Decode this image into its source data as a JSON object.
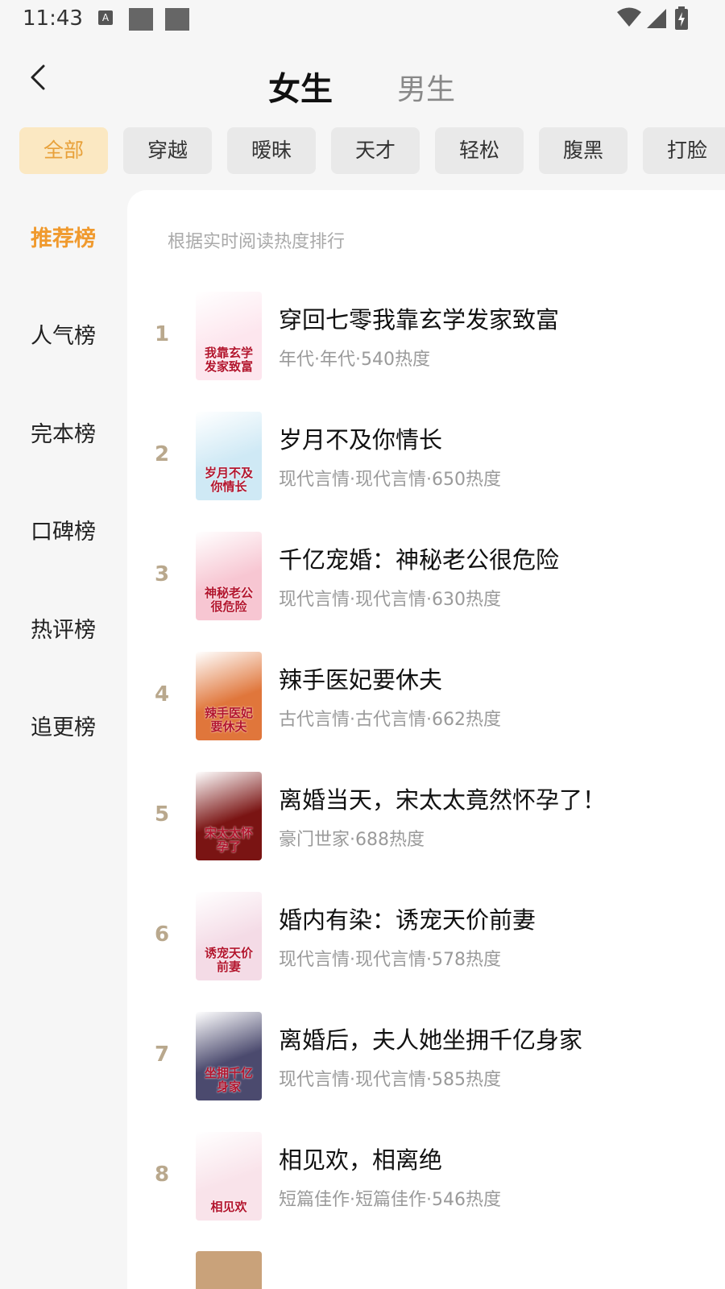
{
  "status_bar": {
    "time": "11:43",
    "icons": [
      "a-icon",
      "notification-square-icon",
      "notification-square-icon",
      "wifi-icon",
      "signal-icon",
      "battery-charging-icon"
    ]
  },
  "header": {
    "back_icon": "back-chevron-icon",
    "tabs": [
      {
        "label": "女生",
        "active": true
      },
      {
        "label": "男生",
        "active": false
      }
    ]
  },
  "filters": [
    {
      "label": "全部",
      "active": true
    },
    {
      "label": "穿越"
    },
    {
      "label": "暧昧"
    },
    {
      "label": "天才"
    },
    {
      "label": "轻松"
    },
    {
      "label": "腹黑"
    },
    {
      "label": "打脸"
    }
  ],
  "side_nav": [
    {
      "label": "推荐榜",
      "active": true
    },
    {
      "label": "人气榜"
    },
    {
      "label": "完本榜"
    },
    {
      "label": "口碑榜"
    },
    {
      "label": "热评榜"
    },
    {
      "label": "追更榜"
    }
  ],
  "list": {
    "subtitle": "根据实时阅读热度排行",
    "books": [
      {
        "rank": "1",
        "title": "穿回七零我靠玄学发家致富",
        "meta": "年代·年代·540热度",
        "cover_text": "我靠玄学发家致富",
        "cover_bg": "#fde6ee"
      },
      {
        "rank": "2",
        "title": "岁月不及你情长",
        "meta": "现代言情·现代言情·650热度",
        "cover_text": "岁月不及你情长",
        "cover_bg": "#cfe9f5"
      },
      {
        "rank": "3",
        "title": "千亿宠婚：神秘老公很危险",
        "meta": "现代言情·现代言情·630热度",
        "cover_text": "神秘老公很危险",
        "cover_bg": "#f7c6d2"
      },
      {
        "rank": "4",
        "title": "辣手医妃要休夫",
        "meta": "古代言情·古代言情·662热度",
        "cover_text": "辣手医妃要休夫",
        "cover_bg": "#e0763b"
      },
      {
        "rank": "5",
        "title": "离婚当天，宋太太竟然怀孕了！",
        "meta": "豪门世家·688热度",
        "cover_text": "宋太太怀孕了",
        "cover_bg": "#7a1413"
      },
      {
        "rank": "6",
        "title": "婚内有染：诱宠天价前妻",
        "meta": "现代言情·现代言情·578热度",
        "cover_text": "诱宠天价前妻",
        "cover_bg": "#f4dbe6"
      },
      {
        "rank": "7",
        "title": "离婚后，夫人她坐拥千亿身家",
        "meta": "现代言情·现代言情·585热度",
        "cover_text": "坐拥千亿身家",
        "cover_bg": "#4b4a6e"
      },
      {
        "rank": "8",
        "title": "相见欢，相离绝",
        "meta": "短篇佳作·短篇佳作·546热度",
        "cover_text": "相见欢",
        "cover_bg": "#f9e3ea"
      }
    ]
  }
}
